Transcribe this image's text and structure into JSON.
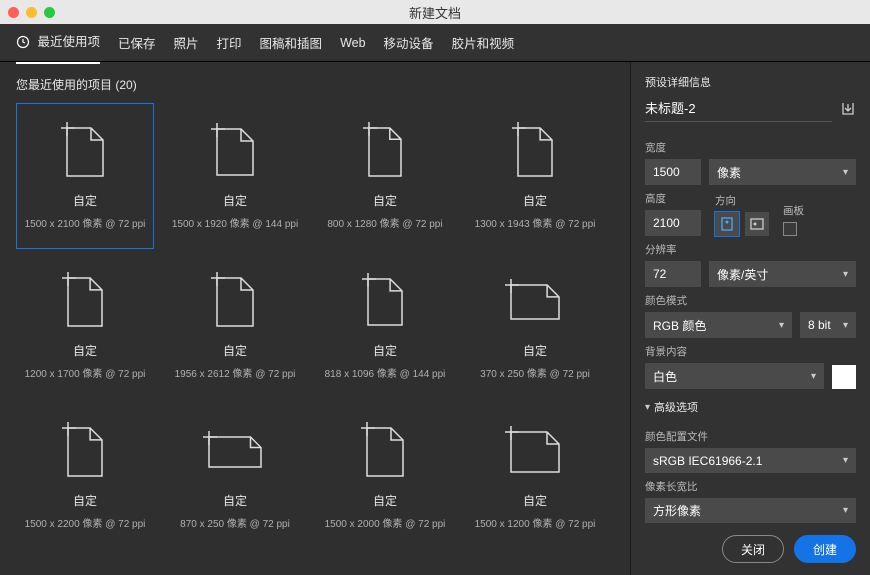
{
  "window": {
    "title": "新建文档"
  },
  "tabs": {
    "items": [
      {
        "label": "最近使用项"
      },
      {
        "label": "已保存"
      },
      {
        "label": "照片"
      },
      {
        "label": "打印"
      },
      {
        "label": "图稿和插图"
      },
      {
        "label": "Web"
      },
      {
        "label": "移动设备"
      },
      {
        "label": "胶片和视频"
      }
    ]
  },
  "left": {
    "header_prefix": "您最近使用的项目",
    "count": "(20)"
  },
  "presets": [
    {
      "name": "自定",
      "details": "1500 x 2100 像素 @ 72 ppi",
      "w": 36,
      "h": 48,
      "selected": true
    },
    {
      "name": "自定",
      "details": "1500 x 1920 像素 @ 144 ppi",
      "w": 36,
      "h": 46
    },
    {
      "name": "自定",
      "details": "800 x 1280 像素 @ 72 ppi",
      "w": 32,
      "h": 48
    },
    {
      "name": "自定",
      "details": "1300 x 1943 像素 @ 72 ppi",
      "w": 34,
      "h": 48
    },
    {
      "name": "自定",
      "details": "1200 x 1700 像素 @ 72 ppi",
      "w": 34,
      "h": 48
    },
    {
      "name": "自定",
      "details": "1956 x 2612 像素 @ 72 ppi",
      "w": 36,
      "h": 48
    },
    {
      "name": "自定",
      "details": "818 x 1096 像素 @ 144 ppi",
      "w": 34,
      "h": 46
    },
    {
      "name": "自定",
      "details": "370 x 250 像素 @ 72 ppi",
      "w": 48,
      "h": 34
    },
    {
      "name": "自定",
      "details": "1500 x 2200 像素 @ 72 ppi",
      "w": 34,
      "h": 48
    },
    {
      "name": "自定",
      "details": "870 x 250 像素 @ 72 ppi",
      "w": 52,
      "h": 30
    },
    {
      "name": "自定",
      "details": "1500 x 2000 像素 @ 72 ppi",
      "w": 36,
      "h": 48
    },
    {
      "name": "自定",
      "details": "1500 x 1200 像素 @ 72 ppi",
      "w": 48,
      "h": 40
    }
  ],
  "details": {
    "section_title": "预设详细信息",
    "doc_name": "未标题-2",
    "width_label": "宽度",
    "width_value": "1500",
    "width_unit": "像素",
    "height_label": "高度",
    "height_value": "2100",
    "orient_label": "方向",
    "artboard_label": "画板",
    "res_label": "分辨率",
    "res_value": "72",
    "res_unit": "像素/英寸",
    "color_label": "颜色模式",
    "color_value": "RGB 颜色",
    "bit_value": "8 bit",
    "bg_label": "背景内容",
    "bg_value": "白色",
    "advanced": "高级选项",
    "profile_label": "颜色配置文件",
    "profile_value": "sRGB IEC61966-2.1",
    "aspect_label": "像素长宽比",
    "aspect_value": "方形像素"
  },
  "footer": {
    "close": "关闭",
    "create": "创建"
  }
}
